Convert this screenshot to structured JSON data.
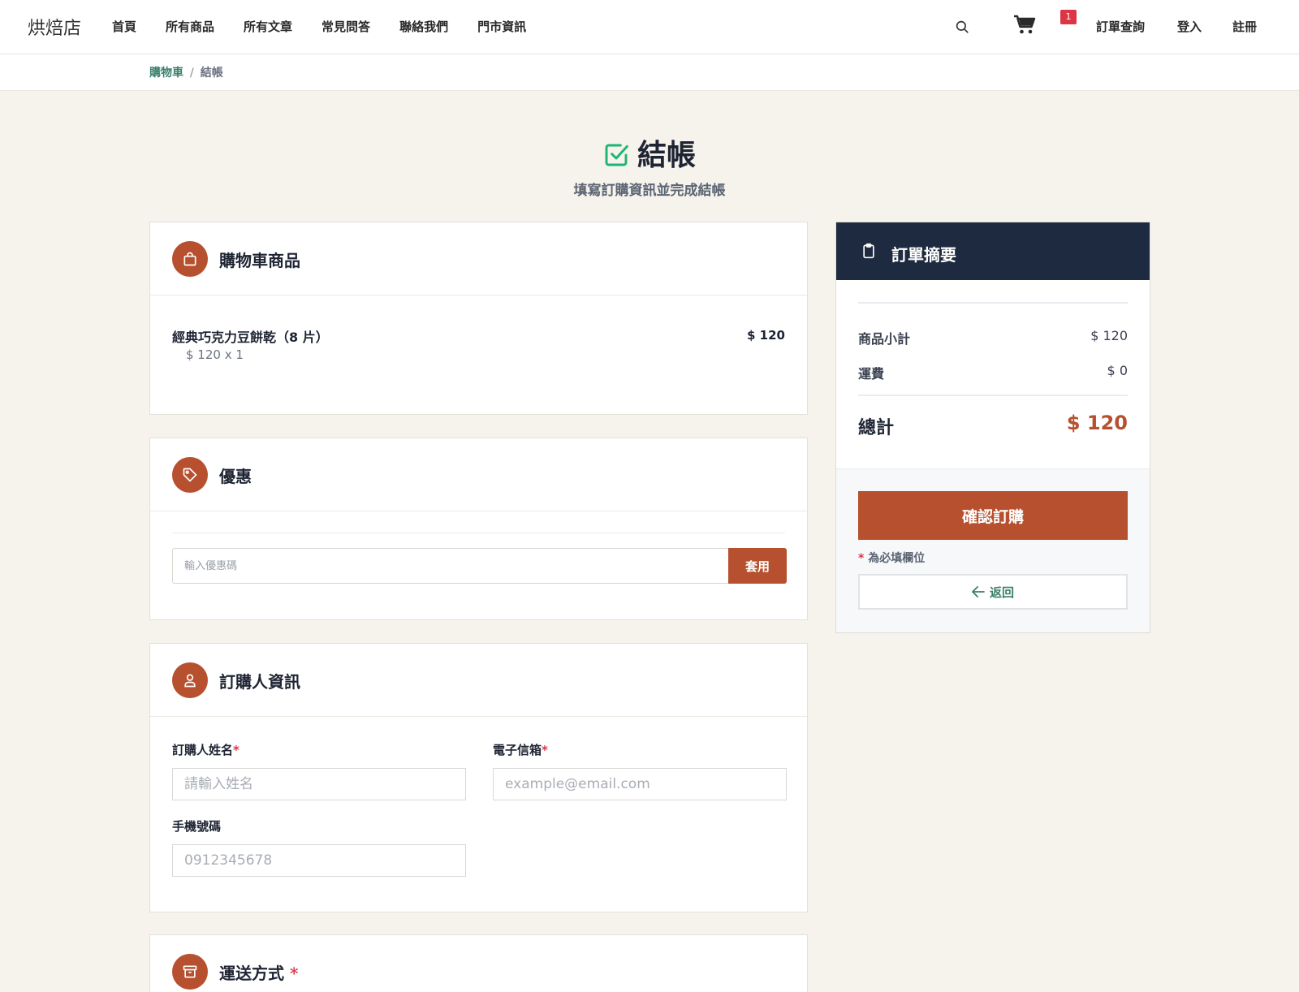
{
  "brand": "烘焙店",
  "nav": {
    "links": [
      "首頁",
      "所有商品",
      "所有文章",
      "常見問答",
      "聯絡我們",
      "門市資訊"
    ],
    "cart_count": "1",
    "order_lookup": "訂單查詢",
    "login": "登入",
    "register": "註冊"
  },
  "breadcrumb": {
    "cart": "購物車",
    "separator": "/",
    "current": "結帳"
  },
  "page": {
    "title": "結帳",
    "subtitle": "填寫訂購資訊並完成結帳"
  },
  "cart_section": {
    "title": "購物車商品",
    "items": [
      {
        "name": "經典巧克力豆餅乾（8 片）",
        "unit_qty": "$ 120 x 1",
        "price": "$ 120"
      }
    ]
  },
  "coupon_section": {
    "title": "優惠",
    "placeholder": "輸入優惠碼",
    "apply_label": "套用"
  },
  "buyer_section": {
    "title": "訂購人資訊",
    "name_label": "訂購人姓名",
    "name_placeholder": "請輸入姓名",
    "email_label": "電子信箱",
    "email_placeholder": "example@email.com",
    "phone_label": "手機號碼",
    "phone_placeholder": "0912345678",
    "required_mark": "*"
  },
  "shipping_section": {
    "title": "運送方式",
    "required_mark": "*"
  },
  "summary": {
    "title": "訂單摘要",
    "subtotal_label": "商品小計",
    "subtotal_value": "$ 120",
    "shipping_label": "運費",
    "shipping_value": "$ 0",
    "total_label": "總計",
    "total_value": "$ 120",
    "confirm_label": "確認訂購",
    "required_note_mark": "*",
    "required_note": "為必填欄位",
    "back_label": "返回"
  },
  "colors": {
    "accent": "#b6502e",
    "navy": "#1e2a3f",
    "green": "#3a7f6b",
    "check": "#1fb574",
    "background": "#f6f2ec",
    "badge": "#dc3545"
  },
  "icons": {
    "search": "search-icon",
    "cart": "cart-icon",
    "title": "check-square-icon",
    "cart_section": "shopping-bag-icon",
    "coupon_section": "tag-icon",
    "buyer_section": "user-icon",
    "shipping_section": "archive-box-icon",
    "summary": "clipboard-icon",
    "back": "arrow-left-icon"
  }
}
